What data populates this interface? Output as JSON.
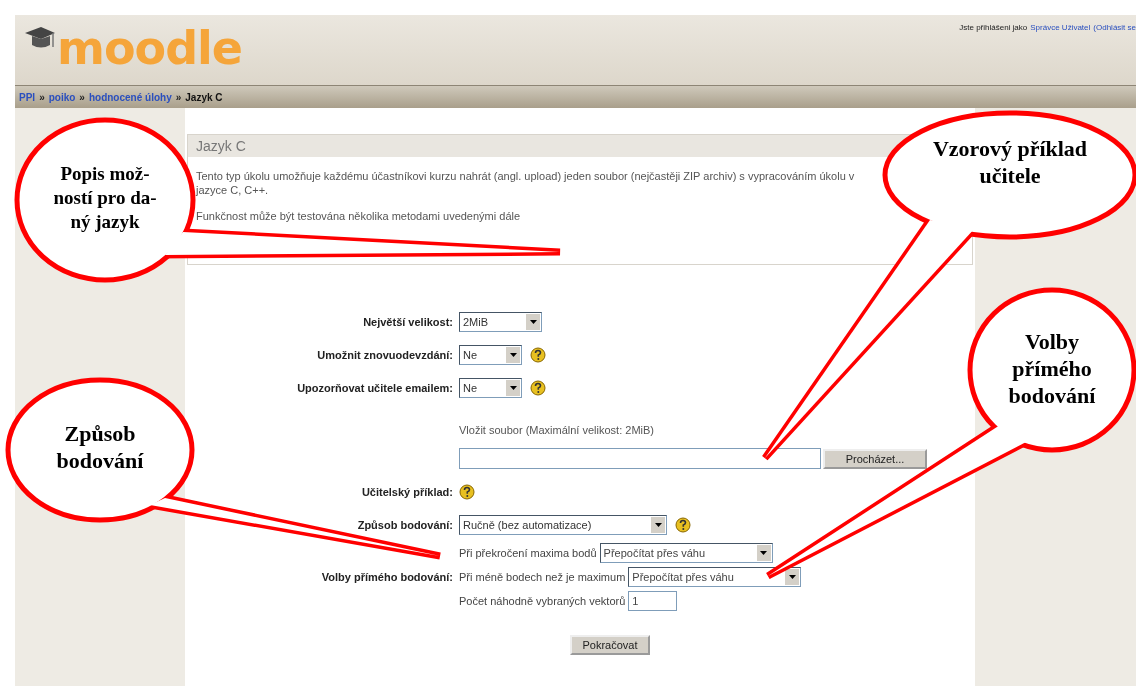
{
  "header": {
    "logo": "moodle",
    "login_text": "Jste přihlášeni jako",
    "user_link": "Správce Uživatel",
    "logout_link": "(Odhlásit se"
  },
  "breadcrumb": [
    {
      "label": "PPI"
    },
    {
      "separator": "»",
      "label": "poiko"
    },
    {
      "separator": "»",
      "label": "hodnocené úlohy"
    },
    {
      "separator": "»",
      "label": "Jazyk C"
    }
  ],
  "box": {
    "title": "Jazyk C",
    "description": "Tento typ úkolu umožňuje každému účastníkovi kurzu nahrát (angl. upload) jeden soubor (nejčastěji ZIP archiv) s vypracováním úkolu v jazyce C, C++.",
    "note": "Funkčnost může být testována několika metodami uvedenými dále"
  },
  "fields": [
    {
      "label": "Největší velikost:",
      "value": "2MiB",
      "help": false
    },
    {
      "label": "Umožnit znovuodevzdání:",
      "value": "Ne",
      "help": true
    },
    {
      "label": "Upozorňovat učitele emailem:",
      "value": "Ne",
      "help": true
    }
  ],
  "upload": {
    "hint": "Vložit soubor (Maximální velikost: 2MiB)",
    "browse": "Procházet...",
    "label": "Učitelský příklad:",
    "help": true
  },
  "grading": {
    "label": "Způsob bodování:",
    "value": "Ručně (bez automatizace)",
    "help": true
  },
  "direct": {
    "label": "Volby přímého bodování:",
    "options": [
      {
        "text": "Při překročení maxima bodů",
        "kind": "select",
        "value": "Přepočítat přes váhu"
      },
      {
        "text": "Při méně bodech než je maximum",
        "kind": "select",
        "value": "Přepočítat přes váhu"
      },
      {
        "text": "Počet náhodně vybraných vektorů",
        "kind": "input",
        "value": "1"
      }
    ]
  },
  "submit": "Pokračovat",
  "callouts": [
    {
      "lines": [
        "Popis mož-",
        "ností pro da-",
        "ný jazyk"
      ]
    },
    {
      "lines": [
        "Vzorový příklad",
        "učitele"
      ]
    },
    {
      "lines": [
        "Volby",
        "přímého",
        "bodování"
      ]
    },
    {
      "lines": [
        "Způsob",
        "bodování"
      ]
    }
  ]
}
